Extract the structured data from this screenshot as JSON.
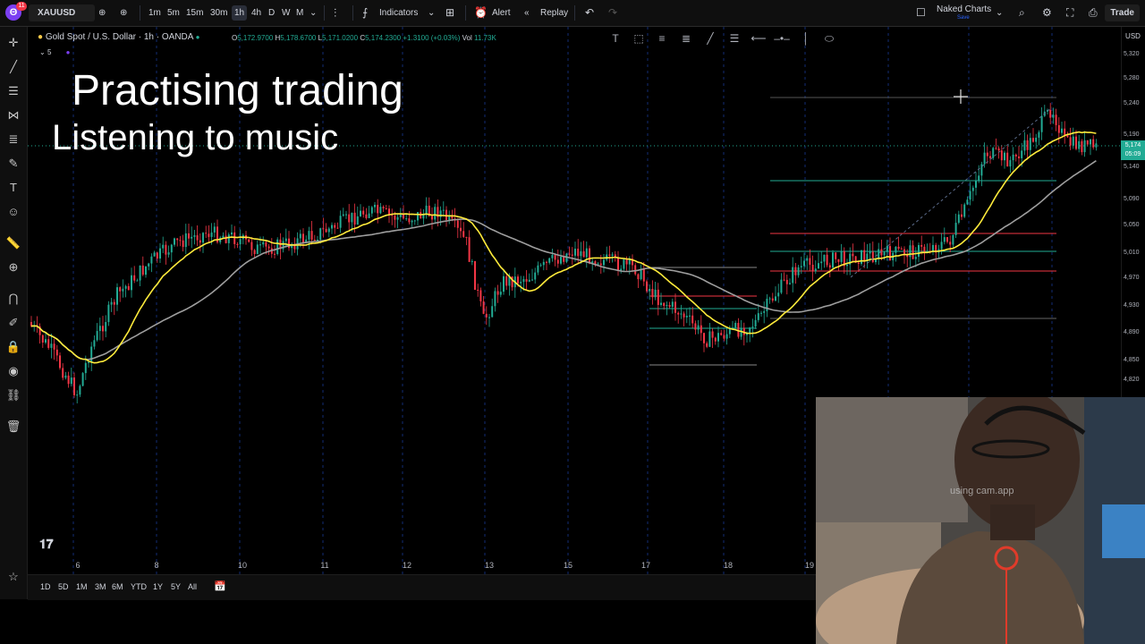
{
  "topbar": {
    "logo_badge": "11",
    "symbol": "XAUUSD",
    "timeframes": [
      "1m",
      "5m",
      "15m",
      "30m",
      "1h",
      "4h",
      "D",
      "W",
      "M"
    ],
    "active_timeframe": "1h",
    "indicators_label": "Indicators",
    "alert_label": "Alert",
    "replay_label": "Replay",
    "layout_name": "Naked Charts",
    "layout_sub": "Save",
    "trade_label": "Trade"
  },
  "legend": {
    "title": "Gold Spot / U.S. Dollar · 1h · OANDA",
    "open_k": "O",
    "open_v": "5,172.9700",
    "high_k": "H",
    "high_v": "5,178.6700",
    "low_k": "L",
    "low_v": "5,171.0200",
    "close_k": "C",
    "close_v": "5,174.2300",
    "change": "+1.3100 (+0.03%)",
    "vol_k": "Vol",
    "vol_v": "11.73K",
    "collapse_count": "5"
  },
  "overlay": {
    "line1": "Practising trading",
    "line2": "Listening to music"
  },
  "price_axis": {
    "currency": "USD",
    "labels": [
      "5,320",
      "5,280",
      "5,240",
      "5,190",
      "5,140",
      "5,090",
      "5,050",
      "5,010",
      "4,970",
      "4,930",
      "4,890",
      "4,850",
      "4,820"
    ],
    "current_price": "5,174",
    "countdown": "05:09"
  },
  "time_axis": {
    "labels": [
      "6",
      "8",
      "10",
      "11",
      "12",
      "13",
      "15",
      "17",
      "18",
      "19"
    ]
  },
  "ranges": [
    "1D",
    "5D",
    "1M",
    "3M",
    "6M",
    "YTD",
    "1Y",
    "5Y",
    "All"
  ],
  "webcam": {
    "watermark": "using  cam.app"
  },
  "colors": {
    "bull": "#22ab94",
    "bear": "#f23645",
    "ma_fast": "#ffeb3b",
    "ma_slow": "#9e9e9e",
    "accent": "#2962ff",
    "current_price_bg": "#22ab94"
  }
}
